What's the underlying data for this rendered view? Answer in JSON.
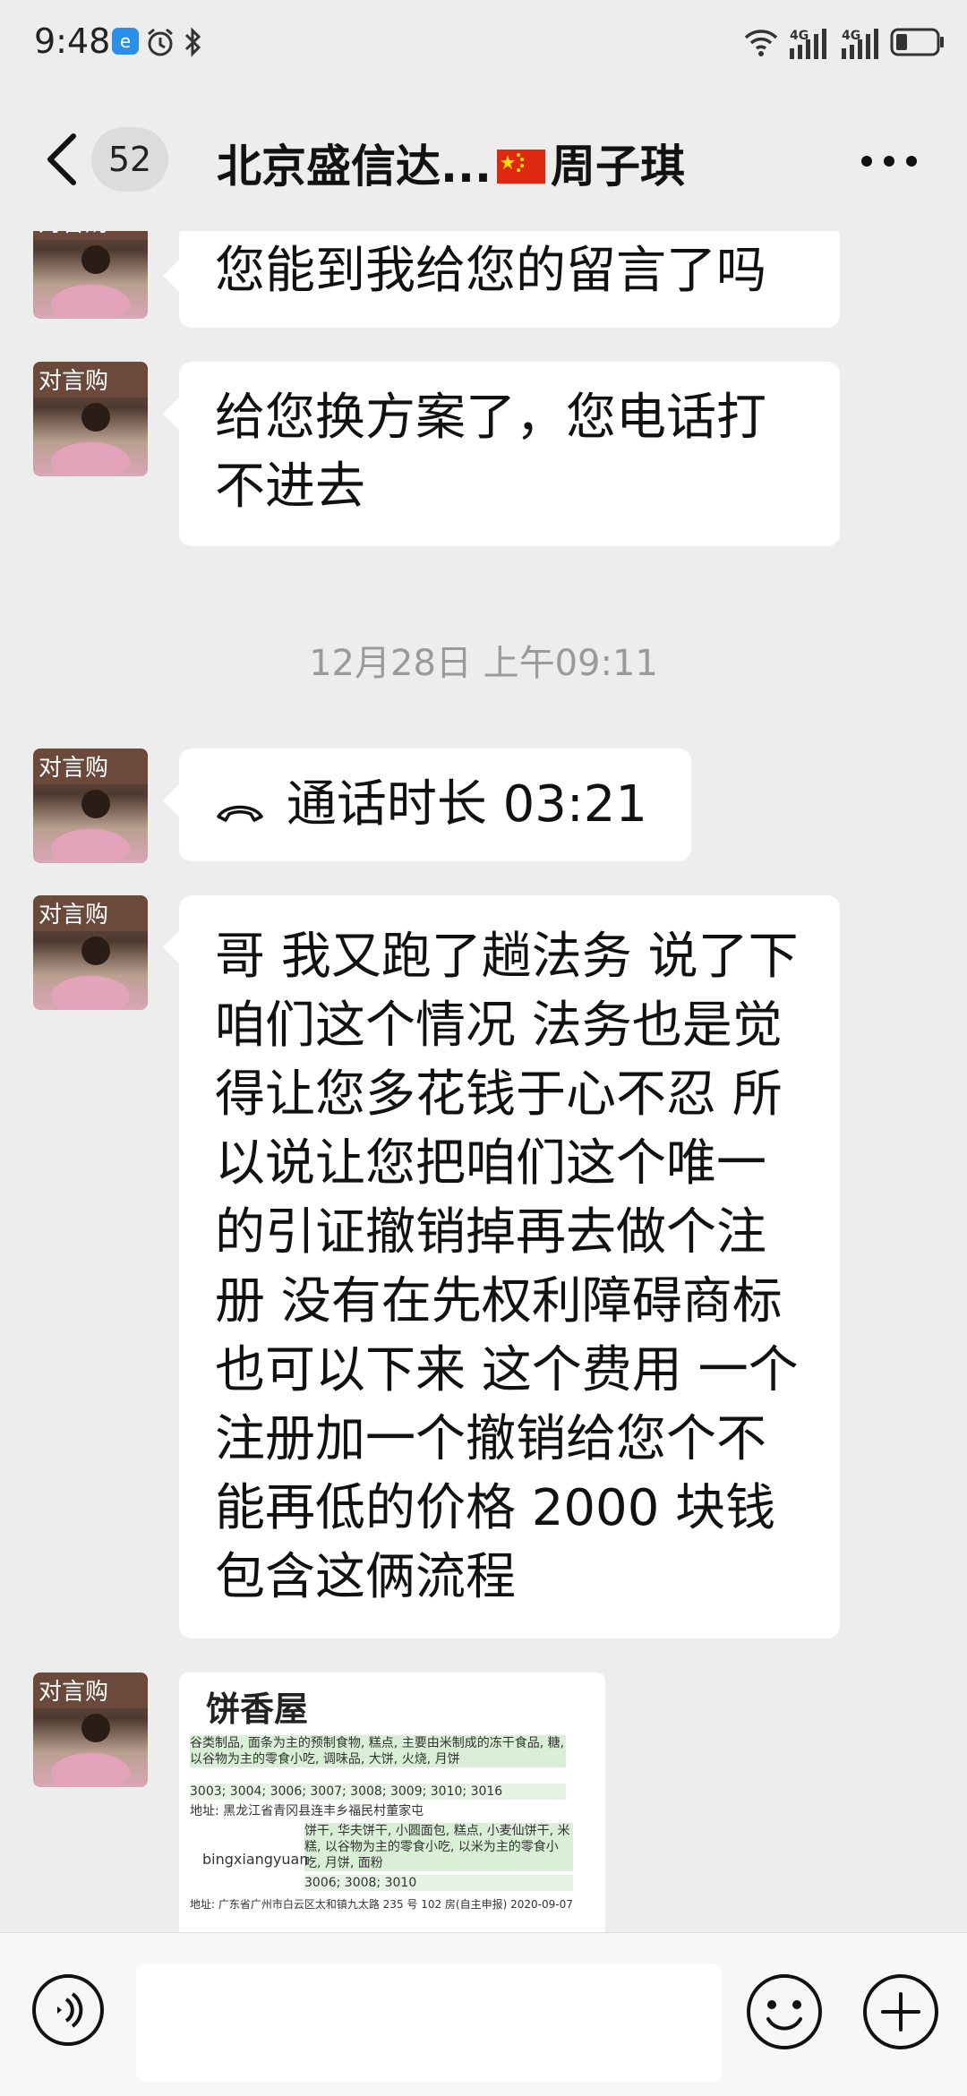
{
  "status_bar": {
    "time": "9:48",
    "network_1": "4G",
    "network_2": "4G"
  },
  "header": {
    "unread_count": "52",
    "title_prefix": "北京盛信达...",
    "title_suffix": "周子琪"
  },
  "messages": [
    {
      "type": "text",
      "text": "您能到我给您的留言了吗"
    },
    {
      "type": "text",
      "lines": [
        "给您换方案了，您电话打",
        "不进去"
      ]
    },
    {
      "type": "timestamp",
      "text": "12月28日 上午09:11"
    },
    {
      "type": "call",
      "label": "通话时长 03:21"
    },
    {
      "type": "text",
      "lines": [
        "哥 我又跑了趟法务 说了下",
        "咱们这个情况 法务也是觉",
        "得让您多花钱于心不忍 所",
        "以说让您把咱们这个唯一",
        "的引证撤销掉再去做个注",
        "册 没有在先权利障碍商标",
        "也可以下来 这个费用 一个",
        "注册加一个撤销给您个不",
        "能再低的价格 2000 块钱",
        "包含这俩流程"
      ]
    },
    {
      "type": "image",
      "logo": "饼香屋",
      "line1": "谷类制品, 面条为主的预制食物, 糕点, 主要由米制成的冻干食品, 糖, 以谷物为主的零食小吃, 调味品, 大饼, 火烧, 月饼",
      "line2": "3003; 3004; 3006; 3007; 3008; 3009; 3010; 3016",
      "line3": "地址: 黑龙江省青冈县连丰乡福民村董家屯",
      "line4": "饼干, 华夫饼干, 小圆面包, 糕点, 小麦仙饼干, 米糕, 以谷物为主的零食小吃, 以米为主的零食小吃, 月饼, 面粉",
      "brand2": "bingxiangyuan",
      "line5": "3006; 3008; 3010",
      "line6": "地址: 广东省广州市白云区太和镇九太路 235 号 102 房(自主申报) 2020-09-07"
    }
  ],
  "input_bar": {
    "placeholder": ""
  }
}
